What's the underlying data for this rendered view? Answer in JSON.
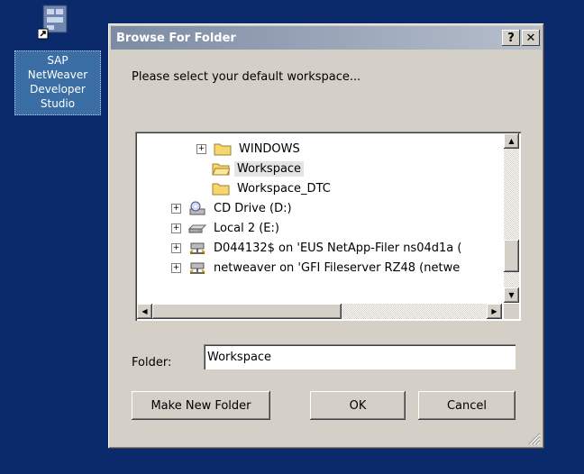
{
  "desktop": {
    "icon_label_lines": [
      "SAP",
      "NetWeaver",
      "Developer",
      "Studio"
    ]
  },
  "dialog": {
    "title": "Browse For Folder",
    "help_button": "?",
    "close_button": "✕",
    "prompt": "Please select your default workspace...",
    "tree_items": [
      {
        "label": "WINDOWS",
        "icon": "folder-icon",
        "expander": "+"
      },
      {
        "label": "Workspace",
        "icon": "folder-open-icon",
        "expander": ""
      },
      {
        "label": "Workspace_DTC",
        "icon": "folder-icon",
        "expander": ""
      },
      {
        "label": "CD Drive (D:)",
        "icon": "cd-drive-icon",
        "expander": "+"
      },
      {
        "label": "Local 2 (E:)",
        "icon": "hard-drive-icon",
        "expander": "+"
      },
      {
        "label": "D044132$ on 'EUS NetApp-Filer ns04d1a (",
        "icon": "network-drive-icon",
        "expander": "+"
      },
      {
        "label": "netweaver on 'GFI Fileserver RZ48 (netwe",
        "icon": "network-drive-icon",
        "expander": "+"
      }
    ],
    "selected_item": "Workspace",
    "folder_label": "Folder:",
    "folder_value": "Workspace",
    "make_new_folder_label": "Make New Folder",
    "ok_label": "OK",
    "cancel_label": "Cancel"
  },
  "colors": {
    "desktop_bg": "#0a2a6b",
    "dialog_bg": "#d4d0c8",
    "title_gradient_start": "#7c8ba3",
    "folder_yellow": "#f5d76e"
  }
}
